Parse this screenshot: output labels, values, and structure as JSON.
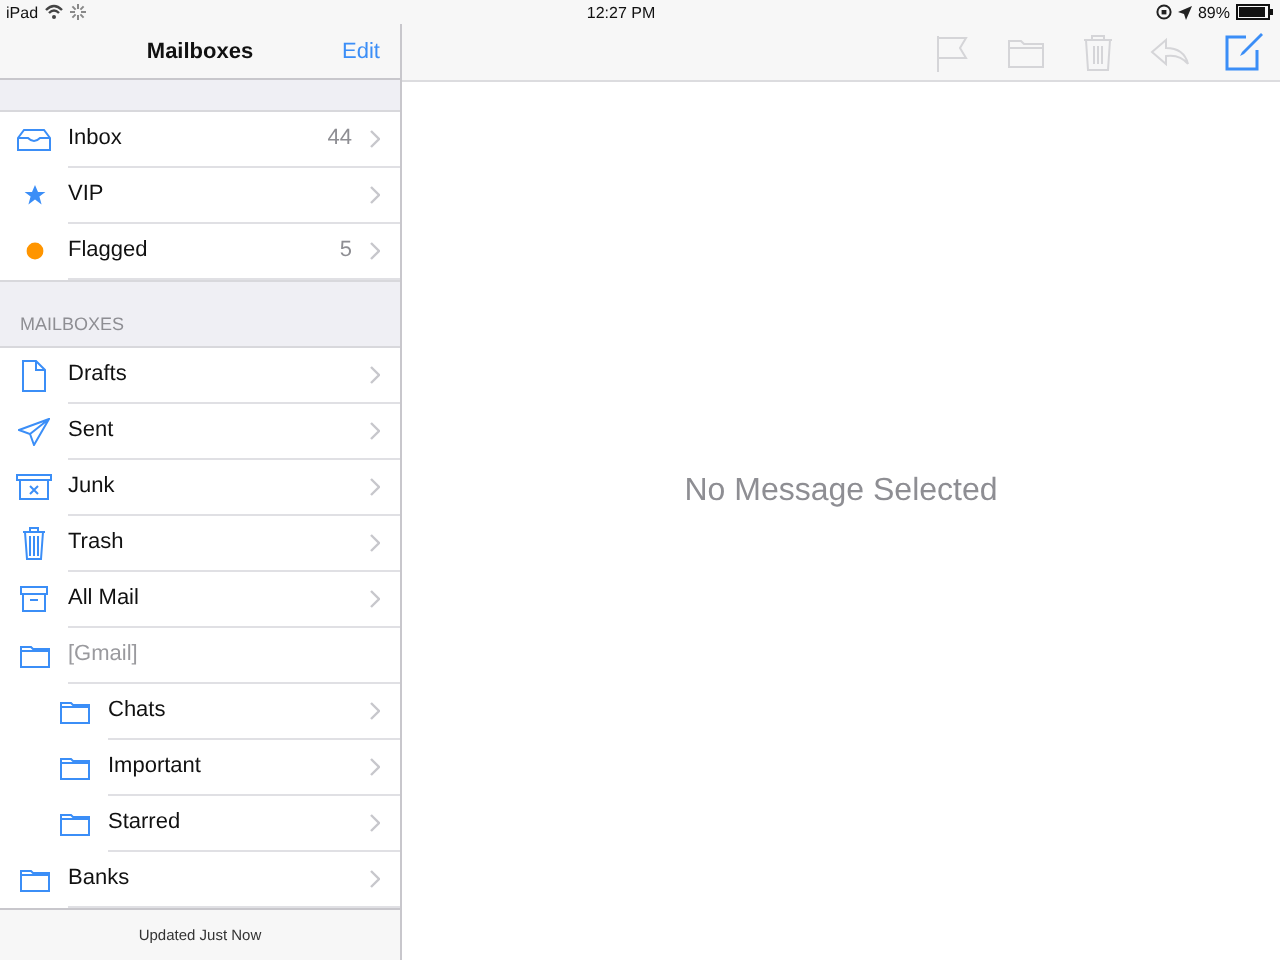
{
  "status_bar": {
    "device": "iPad",
    "time": "12:27 PM",
    "battery": "89%"
  },
  "sidebar": {
    "title": "Mailboxes",
    "edit": "Edit",
    "favorites": [
      {
        "kind": "inbox",
        "label": "Inbox",
        "count": "44"
      },
      {
        "kind": "vip",
        "label": "VIP"
      },
      {
        "kind": "flagged",
        "label": "Flagged",
        "count": "5"
      }
    ],
    "section_title": "MAILBOXES",
    "mailboxes": [
      {
        "kind": "drafts",
        "label": "Drafts",
        "disabled": false
      },
      {
        "kind": "sent",
        "label": "Sent",
        "disabled": false
      },
      {
        "kind": "junk",
        "label": "Junk",
        "disabled": false
      },
      {
        "kind": "trash",
        "label": "Trash",
        "disabled": false
      },
      {
        "kind": "archive",
        "label": "All Mail",
        "disabled": false
      },
      {
        "kind": "folder",
        "label": "[Gmail]",
        "disabled": true,
        "children": [
          {
            "kind": "folder",
            "label": "Chats",
            "disabled": false
          },
          {
            "kind": "folder",
            "label": "Important",
            "disabled": false
          },
          {
            "kind": "folder",
            "label": "Starred",
            "disabled": false
          }
        ]
      },
      {
        "kind": "folder",
        "label": "Banks",
        "disabled": false
      }
    ],
    "footer": "Updated Just Now"
  },
  "toolbar": [
    {
      "kind": "flag",
      "disabled": true
    },
    {
      "kind": "move",
      "disabled": true
    },
    {
      "kind": "trash",
      "disabled": true
    },
    {
      "kind": "reply",
      "disabled": true
    },
    {
      "kind": "compose",
      "disabled": false
    }
  ],
  "message_pane": {
    "empty_text": "No Message Selected"
  }
}
